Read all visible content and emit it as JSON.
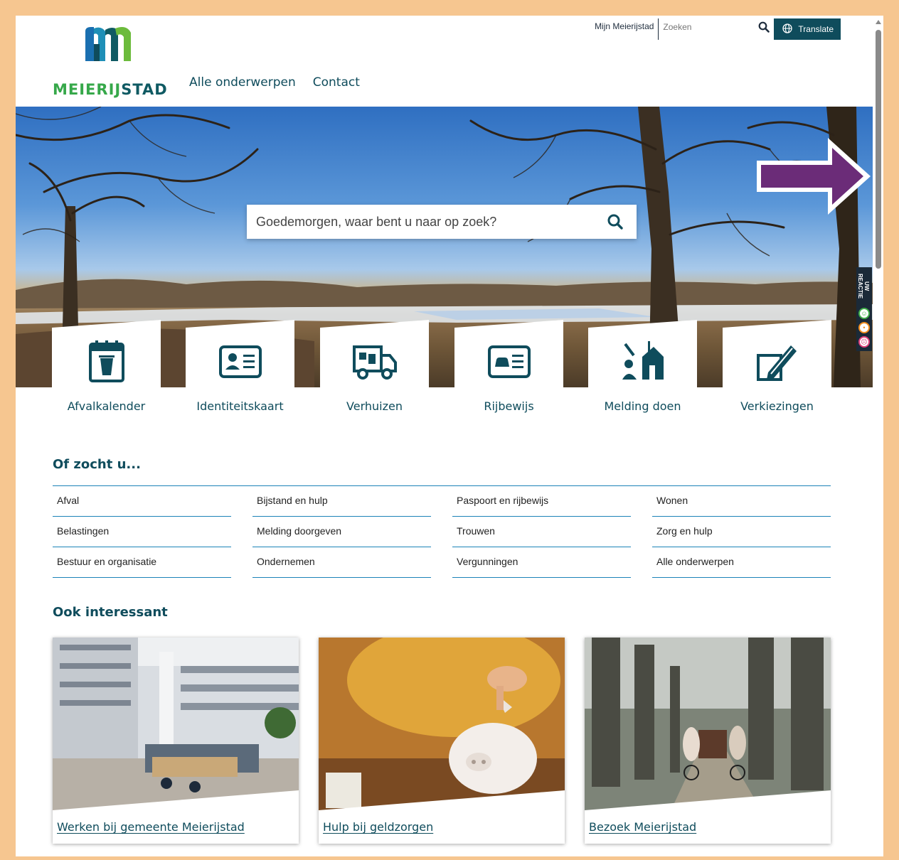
{
  "header": {
    "logo_text_green": "MEIERIJ",
    "logo_text_dark": "STAD",
    "nav": [
      "Alle onderwerpen",
      "Contact"
    ],
    "mijn_link": "Mijn Meierijstad",
    "search_placeholder": "Zoeken",
    "translate_label": "Translate"
  },
  "hero": {
    "search_placeholder": "Goedemorgen, waar bent u naar op zoek?",
    "feedback_label": "UW REACTIE"
  },
  "tiles": [
    {
      "label": "Afvalkalender",
      "icon": "calendar-bin-icon"
    },
    {
      "label": "Identiteitskaart",
      "icon": "id-card-icon"
    },
    {
      "label": "Verhuizen",
      "icon": "moving-truck-icon"
    },
    {
      "label": "Rijbewijs",
      "icon": "driving-license-icon"
    },
    {
      "label": "Melding doen",
      "icon": "report-issue-icon"
    },
    {
      "label": "Verkiezingen",
      "icon": "pen-vote-icon"
    }
  ],
  "of_zocht_u": {
    "title": "Of zocht u...",
    "columns": [
      [
        "Afval",
        "Belastingen",
        "Bestuur en organisatie"
      ],
      [
        "Bijstand en hulp",
        "Melding doorgeven",
        "Ondernemen"
      ],
      [
        "Paspoort en rijbewijs",
        "Trouwen",
        "Vergunningen"
      ],
      [
        "Wonen",
        "Zorg en hulp",
        "Alle onderwerpen"
      ]
    ]
  },
  "ook_interessant": {
    "title": "Ook interessant",
    "cards": [
      {
        "label": "Werken bij gemeente Meierijstad"
      },
      {
        "label": "Hulp bij geldzorgen"
      },
      {
        "label": "Bezoek Meierijstad"
      }
    ]
  },
  "colors": {
    "brand_dark": "#0f4c5c",
    "brand_green": "#36a84a",
    "rule_blue": "#1c83b8",
    "frame_orange": "#f6c690",
    "arrow_purple": "#6b2c78"
  }
}
